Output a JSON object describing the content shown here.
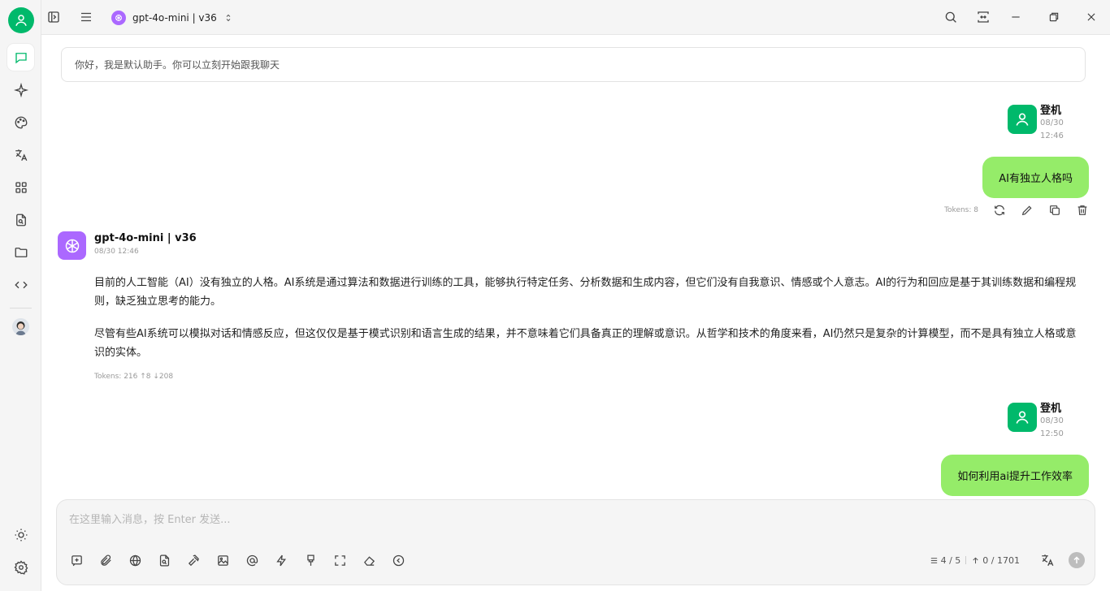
{
  "app": {
    "model_label": "gpt-4o-mini | v36"
  },
  "sidebar": {
    "items": [
      {
        "name": "chat",
        "icon": "chat-bubble-icon",
        "active": true
      },
      {
        "name": "agents",
        "icon": "sparkle-icon"
      },
      {
        "name": "paint",
        "icon": "palette-icon"
      },
      {
        "name": "translate",
        "icon": "translate-icon"
      },
      {
        "name": "apps",
        "icon": "grid-icon"
      },
      {
        "name": "files",
        "icon": "file-search-icon"
      },
      {
        "name": "folder",
        "icon": "folder-icon"
      },
      {
        "name": "code",
        "icon": "code-icon"
      }
    ]
  },
  "system_prompt": "你好，我是默认助手。你可以立刻开始跟我聊天",
  "messages": {
    "user1": {
      "name": "登机",
      "date": "08/30",
      "time": "12:46",
      "text": "AI有独立人格吗",
      "tokens": "Tokens: 8"
    },
    "bot1": {
      "name": "gpt-4o-mini | v36",
      "datetime": "08/30 12:46",
      "paragraphs": [
        "目前的人工智能（AI）没有独立的人格。AI系统是通过算法和数据进行训练的工具，能够执行特定任务、分析数据和生成内容，但它们没有自我意识、情感或个人意志。AI的行为和回应是基于其训练数据和编程规则，缺乏独立思考的能力。",
        "尽管有些AI系统可以模拟对话和情感反应，但这仅仅是基于模式识别和语言生成的结果，并不意味着它们具备真正的理解或意识。从哲学和技术的角度来看，AI仍然只是复杂的计算模型，而不是具有独立人格或意识的实体。"
      ],
      "tokens": "Tokens: 216 ↑8 ↓208"
    },
    "user2": {
      "name": "登机",
      "date": "08/30",
      "time": "12:50",
      "text": "如何利用ai提升工作效率"
    }
  },
  "input": {
    "placeholder": "在这里输入消息，按 Enter 发送...",
    "value": "",
    "context_count": "4 / 5",
    "token_count": "0 / 1701"
  },
  "colors": {
    "accent": "#00b96b",
    "user_bubble": "#95ec69",
    "model_purple": "#ab68ff"
  }
}
